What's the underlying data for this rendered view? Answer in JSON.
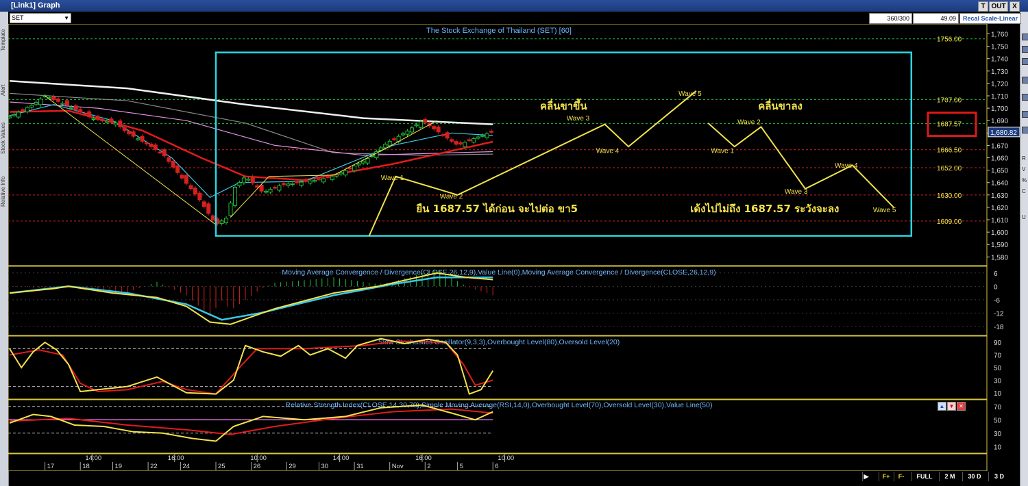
{
  "window": {
    "title": "[Link1] Graph",
    "btn_t": "T",
    "btn_out": "OUT",
    "btn_close": "X"
  },
  "left_tabs": [
    "Template",
    "Alert",
    "Stock Values",
    "Relative Info"
  ],
  "toolbar": {
    "symbol": "SET",
    "bars_count": "360/300",
    "value": "49.09",
    "scale_mode": "Recal Scale-Linear"
  },
  "bottom_bar": {
    "zoom_in": "F+",
    "zoom_out": "F-",
    "full": "FULL",
    "m2": "2 M",
    "d30": "30 D",
    "d3": "3 D"
  },
  "right_labels": [
    "R",
    "V",
    "%",
    "C",
    "U"
  ],
  "chart_data": [
    {
      "type": "candlestick",
      "title": "The Stock Exchange of Thailand (SET) [60]",
      "ylim": [
        1573,
        1768
      ],
      "y_ticks": [
        1580,
        1590,
        1600,
        1610,
        1620,
        1630,
        1640,
        1650,
        1660,
        1670,
        1680,
        1690,
        1700,
        1710,
        1720,
        1730,
        1740,
        1750,
        1760
      ],
      "tick_labels": [
        "1,580",
        "1,590",
        "1,600",
        "1,610",
        "1,620",
        "1,630",
        "1,640",
        "1,650",
        "1,660",
        "1,670",
        "1,680",
        "1,690",
        "1,700",
        "1,710",
        "1,720",
        "1,730",
        "1,740",
        "1,750",
        "1,760"
      ],
      "last_price": "1,680.82",
      "last_price_value": 1680.82,
      "levels": [
        {
          "label": "1756.00",
          "value": 1756.0,
          "color": "#1fbf3a"
        },
        {
          "label": "1707.00",
          "value": 1707.0,
          "color": "#1fbf3a"
        },
        {
          "label": "1687.57",
          "value": 1687.57,
          "color": "#1fbf3a"
        },
        {
          "label": "1666.50",
          "value": 1666.5,
          "color": "#d42020"
        },
        {
          "label": "1652.00",
          "value": 1652.0,
          "color": "#d42020"
        },
        {
          "label": "1630.00",
          "value": 1630.0,
          "color": "#d42020"
        },
        {
          "label": "1609.00",
          "value": 1609.0,
          "color": "#d42020"
        }
      ],
      "x_time_labels": [
        {
          "label": "14:00",
          "bar": 28
        },
        {
          "label": "16:00",
          "bar": 56
        },
        {
          "label": "10:00",
          "bar": 84
        },
        {
          "label": "14:00",
          "bar": 112
        },
        {
          "label": "16:00",
          "bar": 140
        },
        {
          "label": "10:00",
          "bar": 168
        }
      ],
      "x_date_labels": [
        {
          "label": "17",
          "bar": 12
        },
        {
          "label": "18",
          "bar": 24
        },
        {
          "label": "19",
          "bar": 35
        },
        {
          "label": "22",
          "bar": 47
        },
        {
          "label": "24",
          "bar": 58
        },
        {
          "label": "25",
          "bar": 70
        },
        {
          "label": "26",
          "bar": 82
        },
        {
          "label": "29",
          "bar": 94
        },
        {
          "label": "30",
          "bar": 105
        },
        {
          "label": "31",
          "bar": 117
        },
        {
          "label": "Nov",
          "bar": 129
        },
        {
          "label": "2",
          "bar": 141
        },
        {
          "label": "5",
          "bar": 152
        },
        {
          "label": "6",
          "bar": 164
        }
      ],
      "price_path": [
        [
          0,
          1693
        ],
        [
          8,
          1703
        ],
        [
          12,
          1710
        ],
        [
          20,
          1702
        ],
        [
          28,
          1692
        ],
        [
          36,
          1688
        ],
        [
          40,
          1680
        ],
        [
          46,
          1672
        ],
        [
          52,
          1663
        ],
        [
          58,
          1645
        ],
        [
          64,
          1628
        ],
        [
          70,
          1606
        ],
        [
          74,
          1612
        ],
        [
          76,
          1635
        ],
        [
          80,
          1645
        ],
        [
          86,
          1632
        ],
        [
          92,
          1638
        ],
        [
          98,
          1640
        ],
        [
          104,
          1642
        ],
        [
          110,
          1645
        ],
        [
          116,
          1652
        ],
        [
          122,
          1660
        ],
        [
          128,
          1672
        ],
        [
          134,
          1680
        ],
        [
          140,
          1690
        ],
        [
          146,
          1680
        ],
        [
          152,
          1670
        ],
        [
          158,
          1676
        ],
        [
          164,
          1681
        ]
      ],
      "ema_white": [
        [
          0,
          1722
        ],
        [
          40,
          1716
        ],
        [
          80,
          1703
        ],
        [
          120,
          1692
        ],
        [
          164,
          1687
        ]
      ],
      "ema_pink": [
        [
          0,
          1705
        ],
        [
          30,
          1700
        ],
        [
          60,
          1690
        ],
        [
          90,
          1670
        ],
        [
          120,
          1662
        ],
        [
          164,
          1665
        ]
      ],
      "ema_gray": [
        [
          0,
          1712
        ],
        [
          40,
          1706
        ],
        [
          80,
          1688
        ],
        [
          110,
          1664
        ],
        [
          140,
          1662
        ],
        [
          164,
          1663
        ]
      ],
      "ema_red": [
        [
          0,
          1697
        ],
        [
          20,
          1698
        ],
        [
          45,
          1682
        ],
        [
          65,
          1660
        ],
        [
          80,
          1645
        ],
        [
          100,
          1642
        ],
        [
          130,
          1655
        ],
        [
          164,
          1673
        ]
      ],
      "ema_cyan": [
        [
          0,
          1694
        ],
        [
          15,
          1703
        ],
        [
          35,
          1690
        ],
        [
          55,
          1660
        ],
        [
          68,
          1628
        ],
        [
          78,
          1640
        ],
        [
          100,
          1641
        ],
        [
          130,
          1670
        ],
        [
          150,
          1680
        ],
        [
          164,
          1678
        ]
      ],
      "forecast_up": [
        [
          122,
          1597
        ],
        [
          131,
          1645
        ],
        [
          152,
          1630
        ],
        [
          202,
          1687
        ],
        [
          210,
          1669
        ],
        [
          233,
          1714
        ]
      ],
      "forecast_down": [
        [
          237,
          1688
        ],
        [
          246,
          1669
        ],
        [
          255,
          1685
        ],
        [
          270,
          1635
        ],
        [
          286,
          1654
        ],
        [
          300,
          1620
        ]
      ],
      "wave_labels_up": [
        {
          "label": "Wave 1",
          "bar": 126,
          "value": 1642
        },
        {
          "label": "Wave 2",
          "bar": 146,
          "value": 1627
        },
        {
          "label": "Wave 3",
          "bar": 189,
          "value": 1690
        },
        {
          "label": "Wave 4",
          "bar": 199,
          "value": 1664
        },
        {
          "label": "Wave 5",
          "bar": 227,
          "value": 1710
        }
      ],
      "wave_labels_down": [
        {
          "label": "Wave 1",
          "bar": 238,
          "value": 1664
        },
        {
          "label": "Wave 2",
          "bar": 247,
          "value": 1687
        },
        {
          "label": "Wave 3",
          "bar": 263,
          "value": 1631
        },
        {
          "label": "Wave 4",
          "bar": 280,
          "value": 1652
        },
        {
          "label": "Wave 5",
          "bar": 293,
          "value": 1616
        }
      ],
      "annotations": {
        "uptrend_title": "คลื่นขาขึ้น",
        "downtrend_title": "คลื่นขาลง",
        "uptrend_note": "ยืน 1687.57 ได้ก่อน จะไปต่อ ขา5",
        "downtrend_note": "เด้งไปไม่ถึง 1687.57 ระวังจะลง"
      },
      "colors": {
        "up": "#1fbf3a",
        "down": "#d42020",
        "box": "#2ad6e0",
        "forecast": "#f2e24a",
        "highlight": "#e01818"
      }
    },
    {
      "type": "line",
      "title": "Moving Average Convergence / Divergence(CLOSE,26,12,9),Value Line(0),Moving Average Convergence / Divergence(CLOSE,26,12,9)",
      "ylim": [
        -22,
        9
      ],
      "tick_labels": [
        "6",
        "0",
        "-6",
        "-12",
        "-18"
      ],
      "y_ticks": [
        6,
        0,
        -6,
        -12,
        -18
      ],
      "macd": [
        [
          0,
          -3
        ],
        [
          15,
          -1
        ],
        [
          20,
          0
        ],
        [
          35,
          -3
        ],
        [
          50,
          -5
        ],
        [
          60,
          -9
        ],
        [
          68,
          -16
        ],
        [
          75,
          -17
        ],
        [
          90,
          -10
        ],
        [
          110,
          -3
        ],
        [
          125,
          0
        ],
        [
          135,
          3
        ],
        [
          145,
          6
        ],
        [
          155,
          4
        ],
        [
          164,
          3
        ]
      ],
      "signal": [
        [
          0,
          -3
        ],
        [
          20,
          0
        ],
        [
          40,
          -3
        ],
        [
          60,
          -8
        ],
        [
          72,
          -15
        ],
        [
          85,
          -12
        ],
        [
          110,
          -4
        ],
        [
          130,
          1
        ],
        [
          145,
          4
        ],
        [
          164,
          4
        ]
      ]
    },
    {
      "type": "line",
      "title": "Slow Stochastics Oscillator(9,3,3),Overbought Level(80),Oversold Level(20)",
      "ylim": [
        0,
        100
      ],
      "tick_labels": [
        "90",
        "70",
        "50",
        "30",
        "10"
      ],
      "y_ticks": [
        90,
        70,
        50,
        30,
        10
      ],
      "levels": [
        80,
        20
      ],
      "k_line": [
        [
          0,
          80
        ],
        [
          4,
          50
        ],
        [
          8,
          75
        ],
        [
          12,
          90
        ],
        [
          16,
          78
        ],
        [
          20,
          55
        ],
        [
          24,
          12
        ],
        [
          30,
          15
        ],
        [
          40,
          20
        ],
        [
          50,
          35
        ],
        [
          54,
          25
        ],
        [
          60,
          10
        ],
        [
          70,
          8
        ],
        [
          76,
          30
        ],
        [
          80,
          85
        ],
        [
          86,
          75
        ],
        [
          92,
          68
        ],
        [
          98,
          85
        ],
        [
          102,
          70
        ],
        [
          108,
          80
        ],
        [
          114,
          65
        ],
        [
          118,
          85
        ],
        [
          126,
          96
        ],
        [
          134,
          88
        ],
        [
          142,
          95
        ],
        [
          148,
          90
        ],
        [
          152,
          70
        ],
        [
          156,
          8
        ],
        [
          160,
          15
        ],
        [
          164,
          45
        ]
      ],
      "d_line": [
        [
          0,
          70
        ],
        [
          10,
          78
        ],
        [
          18,
          70
        ],
        [
          24,
          25
        ],
        [
          30,
          12
        ],
        [
          40,
          15
        ],
        [
          52,
          28
        ],
        [
          60,
          15
        ],
        [
          70,
          8
        ],
        [
          78,
          50
        ],
        [
          84,
          80
        ],
        [
          100,
          80
        ],
        [
          120,
          85
        ],
        [
          132,
          92
        ],
        [
          148,
          90
        ],
        [
          154,
          55
        ],
        [
          158,
          22
        ],
        [
          164,
          30
        ]
      ]
    },
    {
      "type": "line",
      "title": "Relative Strength Index(CLOSE,14,30,70),Simple Moving Average(RSI,14,0),Overbought Level(70),Oversold Level(30),Value Line(50)",
      "ylim": [
        0,
        80
      ],
      "tick_labels": [
        "70",
        "50",
        "30",
        "10"
      ],
      "y_ticks": [
        70,
        50,
        30,
        10
      ],
      "levels": [
        70,
        30,
        50
      ],
      "rsi": [
        [
          0,
          45
        ],
        [
          8,
          58
        ],
        [
          14,
          55
        ],
        [
          22,
          42
        ],
        [
          32,
          40
        ],
        [
          42,
          32
        ],
        [
          52,
          30
        ],
        [
          62,
          22
        ],
        [
          70,
          18
        ],
        [
          76,
          40
        ],
        [
          86,
          55
        ],
        [
          100,
          50
        ],
        [
          114,
          55
        ],
        [
          126,
          68
        ],
        [
          140,
          72
        ],
        [
          150,
          60
        ],
        [
          158,
          50
        ],
        [
          164,
          62
        ]
      ],
      "sma": [
        [
          0,
          48
        ],
        [
          20,
          52
        ],
        [
          40,
          42
        ],
        [
          60,
          35
        ],
        [
          75,
          28
        ],
        [
          90,
          40
        ],
        [
          110,
          52
        ],
        [
          130,
          62
        ],
        [
          150,
          66
        ],
        [
          164,
          60
        ]
      ]
    }
  ]
}
